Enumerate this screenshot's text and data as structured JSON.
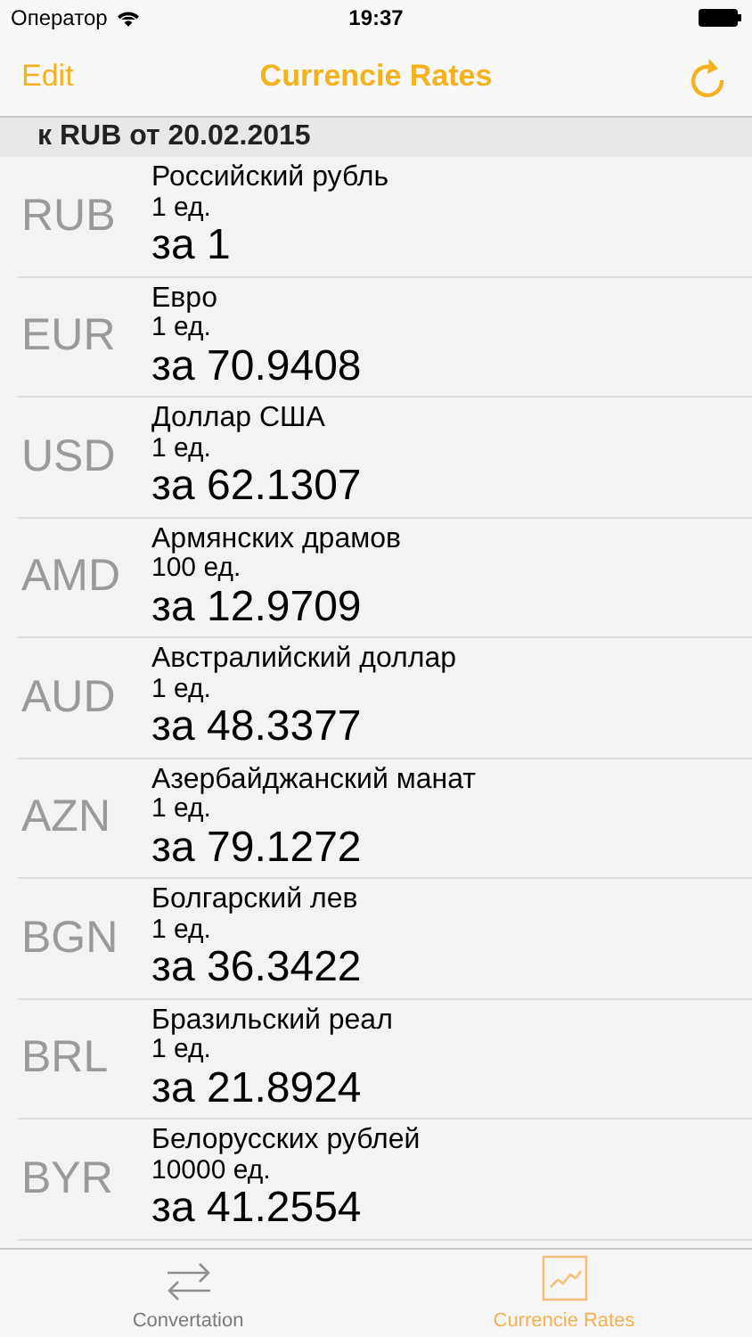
{
  "status_bar": {
    "carrier": "Оператор",
    "time": "19:37"
  },
  "nav": {
    "left": "Edit",
    "title": "Currencie Rates"
  },
  "section": {
    "title": "к RUB от 20.02.2015"
  },
  "rows": [
    {
      "code": "RUB",
      "name": "Российский рубль",
      "units": "1 ед.",
      "rate": "за 1"
    },
    {
      "code": "EUR",
      "name": "Евро",
      "units": "1 ед.",
      "rate": "за 70.9408"
    },
    {
      "code": "USD",
      "name": "Доллар США",
      "units": "1 ед.",
      "rate": "за 62.1307"
    },
    {
      "code": "AMD",
      "name": "Армянских драмов",
      "units": "100 ед.",
      "rate": "за 12.9709"
    },
    {
      "code": "AUD",
      "name": "Австралийский доллар",
      "units": "1 ед.",
      "rate": "за 48.3377"
    },
    {
      "code": "AZN",
      "name": "Азербайджанский манат",
      "units": "1 ед.",
      "rate": "за 79.1272"
    },
    {
      "code": "BGN",
      "name": "Болгарский лев",
      "units": "1 ед.",
      "rate": "за 36.3422"
    },
    {
      "code": "BRL",
      "name": "Бразильский реал",
      "units": "1 ед.",
      "rate": "за 21.8924"
    },
    {
      "code": "BYR",
      "name": "Белорусских рублей",
      "units": "10000 ед.",
      "rate": "за 41.2554"
    }
  ],
  "tabs": [
    {
      "kind": "convert",
      "label": "Convertation",
      "selected": false
    },
    {
      "kind": "rates",
      "label": "Currencie Rates",
      "selected": true
    }
  ]
}
